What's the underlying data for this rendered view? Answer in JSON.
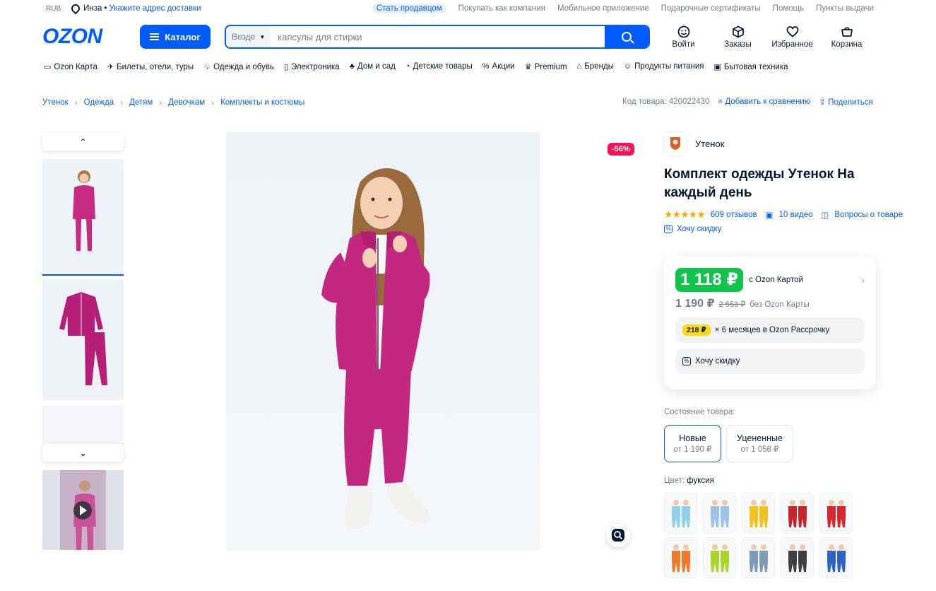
{
  "topbar": {
    "currency": "RUB",
    "city": "Инза",
    "address_link": "Укажите адрес доставки",
    "links": [
      "Стать продавцом",
      "Покупать как компания",
      "Мобильное приложение",
      "Подарочные сертификаты",
      "Помощь",
      "Пункты выдачи"
    ]
  },
  "header": {
    "logo": "OZON",
    "catalog_label": "Каталог",
    "search_scope": "Везде",
    "search_placeholder": "капсулы для стирки",
    "nav": [
      {
        "label": "Войти",
        "icon": "user-icon"
      },
      {
        "label": "Заказы",
        "icon": "box-icon"
      },
      {
        "label": "Избранное",
        "icon": "heart-icon"
      },
      {
        "label": "Корзина",
        "icon": "cart-icon"
      }
    ]
  },
  "categories": [
    "Ozon Карта",
    "Билеты, отели, туры",
    "Одежда и обувь",
    "Электроника",
    "Дом и сад",
    "Детские товары",
    "Акции",
    "Premium",
    "Бренды",
    "Продукты питания",
    "Бытовая техника"
  ],
  "breadcrumb": [
    "Утенок",
    "Одежда",
    "Детям",
    "Девочкам",
    "Комплекты и костюмы"
  ],
  "product_meta": {
    "code": "Код товара: 420022430",
    "compare": "Добавить к сравнению",
    "share": "Поделиться"
  },
  "discount_badge": "-56%",
  "product": {
    "brand": "Утенок",
    "title": "Комплект одежды Утенок На каждый день",
    "reviews": "609 отзывов",
    "videos": "10 видео",
    "questions": "Вопросы о товаре",
    "want_discount": "Хочу скидку"
  },
  "price": {
    "card_price": "1 118 ₽",
    "card_label": "с Ozon Картой",
    "regular_price": "1 190 ₽",
    "old_price": "2 553 ₽",
    "regular_label": "без Ozon Карты",
    "installment_amount": "218 ₽",
    "installment_text": "× 6 месяцев в Ozon Рассрочку",
    "want_discount": "Хочу скидку"
  },
  "condition": {
    "label": "Состояние товара:",
    "options": [
      {
        "title": "Новые",
        "price": "от 1 190 ₽"
      },
      {
        "title": "Уцененные",
        "price": "от 1 058 ₽"
      }
    ]
  },
  "color": {
    "label": "Цвет:",
    "value": "фуксия",
    "swatches": [
      "#8fd0ea",
      "#9ec3e8",
      "#f2c21b",
      "#c9242b",
      "#d8262e",
      "#f07a2a",
      "#a8d42c",
      "#7d9ab7",
      "#3c3f44",
      "#2f62c9"
    ]
  }
}
